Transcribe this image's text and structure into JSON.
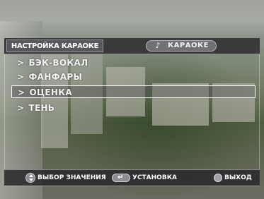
{
  "header": {
    "title": "НАСТРОЙКА КАРАОКЕ",
    "mode_label": "КАРАОКЕ",
    "mode_icon": "music-note-icon"
  },
  "menu": {
    "items": [
      {
        "arrow": ">",
        "label": "БЭК-ВОКАЛ",
        "selected": false
      },
      {
        "arrow": ">",
        "label": "ФАНФАРЫ",
        "selected": false
      },
      {
        "arrow": ">",
        "label": "ОЦЕНКА",
        "selected": true
      },
      {
        "arrow": ">",
        "label": "ТЕНЬ",
        "selected": false
      }
    ]
  },
  "footer": {
    "select_label": "ВЫБОР ЗНАЧЕНИЯ",
    "set_label": "УСТАНОВКА",
    "exit_label": "ВЫХОД",
    "icons": [
      "up-down-icon",
      "enter-icon",
      "exit-button-icon"
    ]
  },
  "colors": {
    "panel": "#3a3a3d",
    "text": "#f4f4f4",
    "selection_border": "#ffffff"
  }
}
